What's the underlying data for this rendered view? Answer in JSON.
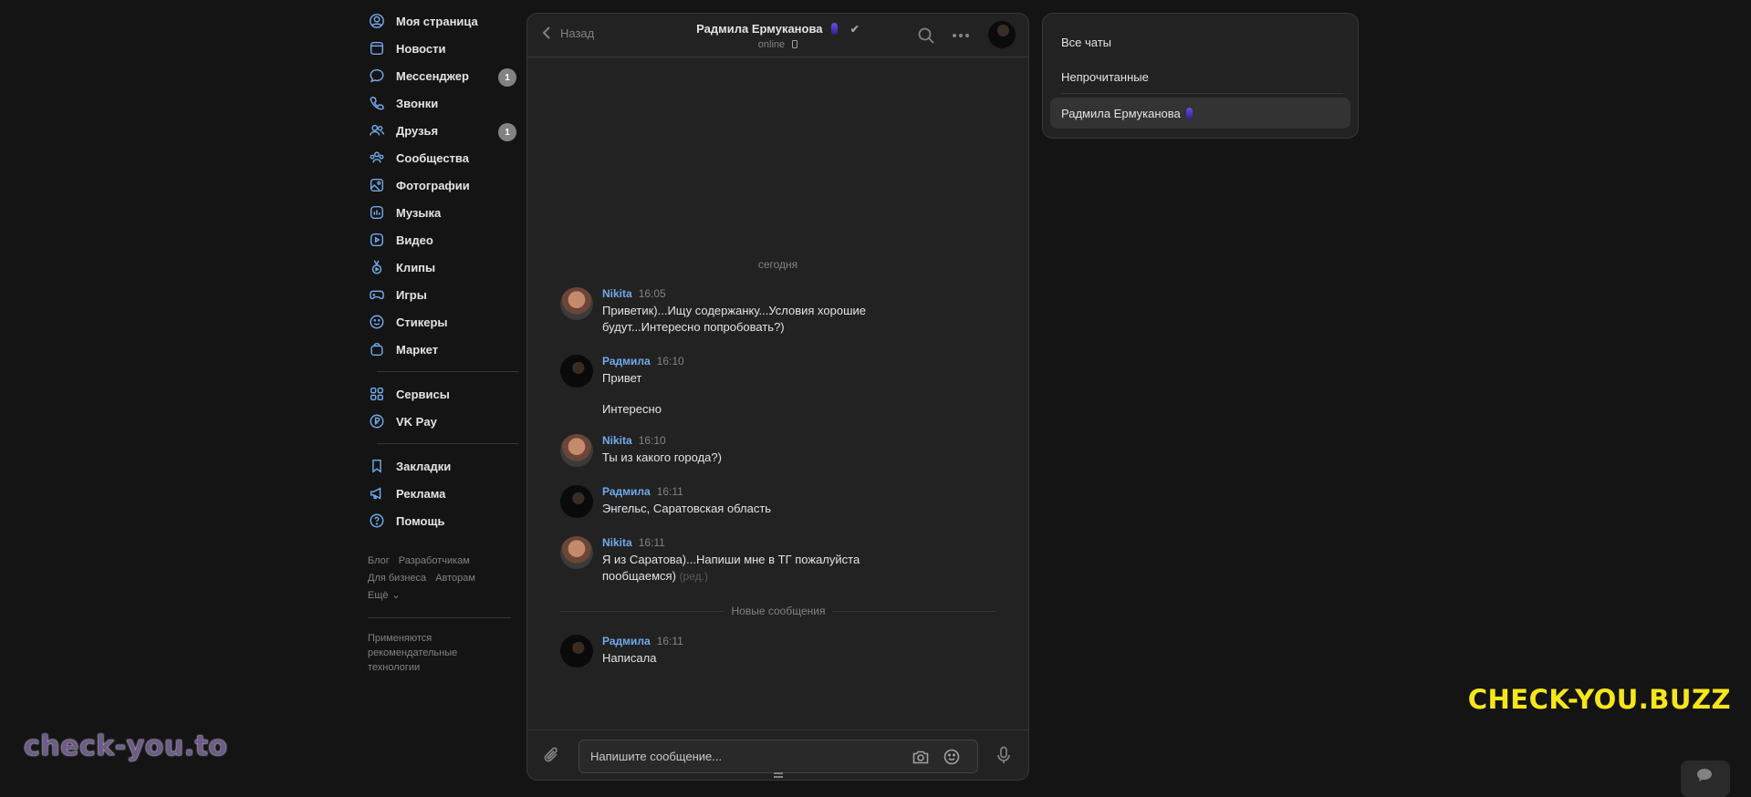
{
  "nav": {
    "items": [
      {
        "label": "Моя страница",
        "icon": "user-circle-icon",
        "badge": ""
      },
      {
        "label": "Новости",
        "icon": "news-icon",
        "badge": ""
      },
      {
        "label": "Мессенджер",
        "icon": "message-icon",
        "badge": "1"
      },
      {
        "label": "Звонки",
        "icon": "phone-icon",
        "badge": ""
      },
      {
        "label": "Друзья",
        "icon": "friends-icon",
        "badge": "1"
      },
      {
        "label": "Сообщества",
        "icon": "communities-icon",
        "badge": ""
      },
      {
        "label": "Фотографии",
        "icon": "photo-icon",
        "badge": ""
      },
      {
        "label": "Музыка",
        "icon": "music-icon",
        "badge": ""
      },
      {
        "label": "Видео",
        "icon": "video-icon",
        "badge": ""
      },
      {
        "label": "Клипы",
        "icon": "clips-icon",
        "badge": ""
      },
      {
        "label": "Игры",
        "icon": "gamepad-icon",
        "badge": ""
      },
      {
        "label": "Стикеры",
        "icon": "smile-icon",
        "badge": ""
      },
      {
        "label": "Маркет",
        "icon": "bag-icon",
        "badge": ""
      }
    ],
    "items2": [
      {
        "label": "Сервисы",
        "icon": "services-icon"
      },
      {
        "label": "VK Pay",
        "icon": "vkpay-icon"
      }
    ],
    "items3": [
      {
        "label": "Закладки",
        "icon": "bookmark-icon"
      },
      {
        "label": "Реклама",
        "icon": "megaphone-icon"
      },
      {
        "label": "Помощь",
        "icon": "help-icon"
      }
    ],
    "footer": {
      "blog": "Блог",
      "developers": "Разработчикам",
      "business": "Для бизнеса",
      "authors": "Авторам",
      "more": "Ещё",
      "note": "Применяются рекомендательные технологии"
    }
  },
  "chat": {
    "back_label": "Назад",
    "title": "Радмила Ермуканова",
    "status": "online",
    "date_label": "сегодня",
    "new_messages_label": "Новые сообщения",
    "composer_placeholder": "Напишите сообщение...",
    "messages": [
      {
        "author": "Nikita",
        "time": "16:05",
        "text": "Приветик)...Ищу содержанку...Условия хорошие будут...Интересно попробовать?)",
        "avatar": "nikita"
      },
      {
        "author": "Радмила",
        "time": "16:10",
        "text": "Привет",
        "text2": "Интересно",
        "avatar": "radmila"
      },
      {
        "author": "Nikita",
        "time": "16:10",
        "text": "Ты из какого города?)",
        "avatar": "nikita"
      },
      {
        "author": "Радмила",
        "time": "16:11",
        "text": "Энгельс, Саратовская область",
        "avatar": "radmila"
      },
      {
        "author": "Nikita",
        "time": "16:11",
        "text": "Я из Саратова)...Напиши мне в ТГ пожалуйста пообщаемся)",
        "edited": "(ред.)",
        "avatar": "nikita"
      },
      {
        "author": "Радмила",
        "time": "16:11",
        "text": "Написала",
        "avatar": "radmila"
      }
    ]
  },
  "right_panel": {
    "all_chats": "Все чаты",
    "unread": "Непрочитанные",
    "current_chat": "Радмила Ермуканова"
  },
  "watermarks": {
    "left": "check-you.to",
    "right": "CHECK-YOU.BUZZ"
  },
  "colors": {
    "accent": "#71aaeb",
    "background": "#141414",
    "panel": "#222222",
    "watermark_right": "#f5e61c"
  }
}
